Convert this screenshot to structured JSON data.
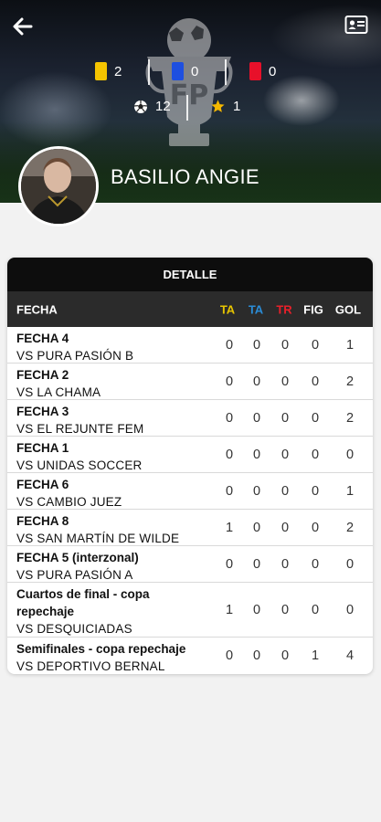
{
  "header": {
    "player_name": "BASILIO ANGIE",
    "stats": {
      "yellow_cards": "2",
      "blue_cards": "0",
      "red_cards": "0",
      "goals": "12",
      "figures": "1"
    }
  },
  "colors": {
    "yellow_card": "#f5c400",
    "blue_card": "#1e4fe0",
    "red_card": "#e8102a",
    "ta_yellow": "#e7c400",
    "ta_blue": "#2b8cd6",
    "tr_red": "#e8202a",
    "table_header": "#2b2b2b",
    "card_title_bg": "#0d0d0d"
  },
  "detail": {
    "title": "DETALLE",
    "columns": {
      "fecha": "FECHA",
      "ta_yellow": "TA",
      "ta_blue": "TA",
      "tr": "TR",
      "fig": "FIG",
      "gol": "GOL"
    },
    "rows": [
      {
        "title": "FECHA 4",
        "rival": "VS PURA PASIÓN B",
        "ta": "0",
        "ta2": "0",
        "tr": "0",
        "fig": "0",
        "gol": "1"
      },
      {
        "title": "FECHA 2",
        "rival": "VS LA CHAMA",
        "ta": "0",
        "ta2": "0",
        "tr": "0",
        "fig": "0",
        "gol": "2"
      },
      {
        "title": "FECHA 3",
        "rival": "VS EL REJUNTE FEM",
        "ta": "0",
        "ta2": "0",
        "tr": "0",
        "fig": "0",
        "gol": "2"
      },
      {
        "title": "FECHA 1",
        "rival": "VS UNIDAS SOCCER",
        "ta": "0",
        "ta2": "0",
        "tr": "0",
        "fig": "0",
        "gol": "0"
      },
      {
        "title": "FECHA 6",
        "rival": "VS CAMBIO JUEZ",
        "ta": "0",
        "ta2": "0",
        "tr": "0",
        "fig": "0",
        "gol": "1"
      },
      {
        "title": "FECHA 8",
        "rival": "VS SAN MARTÍN DE WILDE",
        "ta": "1",
        "ta2": "0",
        "tr": "0",
        "fig": "0",
        "gol": "2"
      },
      {
        "title": "FECHA 5 (interzonal)",
        "rival": "VS PURA PASIÓN A",
        "ta": "0",
        "ta2": "0",
        "tr": "0",
        "fig": "0",
        "gol": "0"
      },
      {
        "title": "Cuartos de final - copa repechaje",
        "rival": "VS DESQUICIADAS",
        "ta": "1",
        "ta2": "0",
        "tr": "0",
        "fig": "0",
        "gol": "0"
      },
      {
        "title": "Semifinales - copa repechaje",
        "rival": "VS DEPORTIVO BERNAL",
        "ta": "0",
        "ta2": "0",
        "tr": "0",
        "fig": "1",
        "gol": "4"
      }
    ]
  },
  "icons": {
    "back": "arrow-left-icon",
    "profile_card": "id-card-icon",
    "ball": "soccer-ball-icon",
    "star": "star-icon",
    "trophy": "trophy-logo-icon"
  }
}
